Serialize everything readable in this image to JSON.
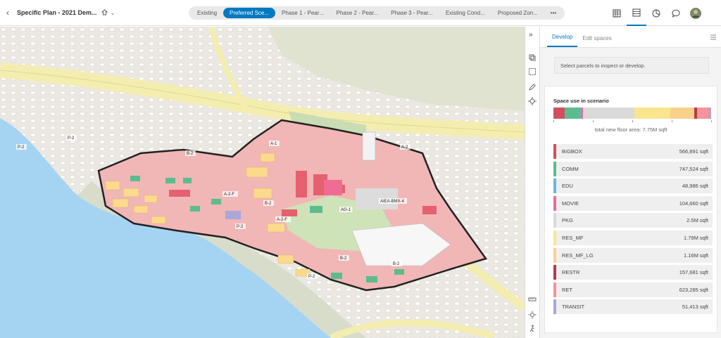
{
  "header": {
    "back_glyph": "‹",
    "title": "Specific Plan - 2021 Dem...",
    "tabs": [
      {
        "label": "Existing",
        "active": false
      },
      {
        "label": "Preferred Sce...",
        "active": true
      },
      {
        "label": "Phase 1 - Pear...",
        "active": false
      },
      {
        "label": "Phase 2 - Pear...",
        "active": false
      },
      {
        "label": "Phase 3 - Pear...",
        "active": false
      },
      {
        "label": "Existing Cond...",
        "active": false
      },
      {
        "label": "Proposed Zon...",
        "active": false
      },
      {
        "label": "•••",
        "active": false
      }
    ],
    "tools": [
      "basemap-icon",
      "table-icon",
      "chart-icon",
      "comment-icon",
      "user-avatar-icon"
    ]
  },
  "map": {
    "zone_labels": [
      "P-2",
      "B-2",
      "A-1",
      "A-2",
      "P-2",
      "A-2-F",
      "B-2",
      "AG-1",
      "AIEA-BMX-4",
      "P-2",
      "A-2-F",
      "B-2",
      "B-2",
      "P-2"
    ]
  },
  "side_tools": {
    "collapse_glyph": "»",
    "icons": [
      "layers-icon",
      "select-icon",
      "edit-icon",
      "locate-icon",
      "measure-icon",
      "sun-icon",
      "walk-icon"
    ]
  },
  "panel": {
    "tabs": [
      {
        "label": "Develop",
        "active": true
      },
      {
        "label": "Edit spaces",
        "active": false
      }
    ],
    "select_prompt": "Select parcels to inspect or develop.",
    "space_title": "Space use in scenario",
    "total_label": "total new floor area: 7.75M sqft",
    "space_uses": [
      {
        "name": "BIGBOX",
        "value": "566,891 sqft",
        "color": "#d1505f",
        "share": 0.073
      },
      {
        "name": "COMM",
        "value": "747,524 sqft",
        "color": "#5bbd8e",
        "share": 0.096
      },
      {
        "name": "EDU",
        "value": "48,986 sqft",
        "color": "#6bb7de",
        "share": 0.006
      },
      {
        "name": "MOVIE",
        "value": "104,660 sqft",
        "color": "#e96f92",
        "share": 0.014
      },
      {
        "name": "PKG",
        "value": "2.5M sqft",
        "color": "#d9d9d9",
        "share": 0.323
      },
      {
        "name": "RES_MF",
        "value": "1.79M sqft",
        "color": "#fbe48e",
        "share": 0.231
      },
      {
        "name": "RES_MF_LG",
        "value": "1.16M sqft",
        "color": "#fad18b",
        "share": 0.15
      },
      {
        "name": "RESTR",
        "value": "157,681 sqft",
        "color": "#b23b4a",
        "share": 0.02
      },
      {
        "name": "RET",
        "value": "623,285 sqft",
        "color": "#f3939c",
        "share": 0.08
      },
      {
        "name": "TRANSIT",
        "value": "51,413 sqft",
        "color": "#aba7d8",
        "share": 0.007
      }
    ]
  }
}
